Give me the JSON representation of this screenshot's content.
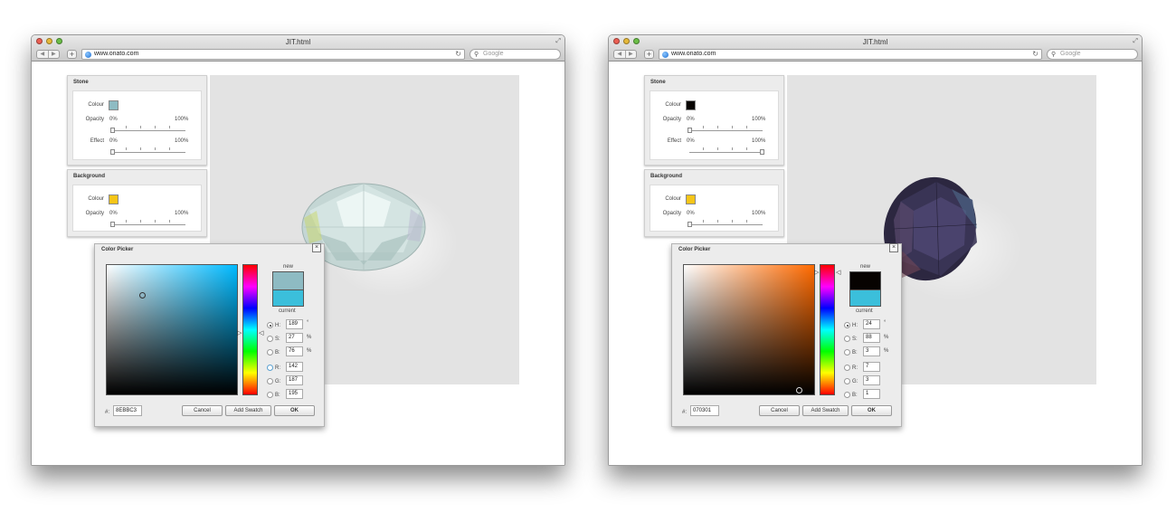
{
  "browser": {
    "title": "JIT.html",
    "url": "www.onato.com",
    "search_placeholder": "Google"
  },
  "panels": {
    "stone_title": "Stone",
    "background_title": "Background",
    "colour_label": "Colour",
    "opacity_label": "Opacity",
    "effect_label": "Effect",
    "min_pct": "0%",
    "max_pct": "100%"
  },
  "picker": {
    "title": "Color Picker",
    "close_glyph": "×",
    "new_label": "new",
    "current_label": "current",
    "h_label": "H:",
    "s_label": "S:",
    "b_label": "B:",
    "r_label": "R:",
    "g_label": "G:",
    "b2_label": "B:",
    "deg_unit": "°",
    "pct_unit": "%",
    "hex_label": "#:",
    "cancel_label": "Cancel",
    "add_swatch_label": "Add Swatch",
    "ok_label": "OK"
  },
  "windows": [
    {
      "stone_colour": "#8ebbc3",
      "background_colour": "#f5c518",
      "stone_opacity": 0,
      "stone_effect": 0,
      "background_opacity": 0,
      "picker_hue_color": "#00baff",
      "new_color": "#8ebbc3",
      "current_color": "#3bbfdb",
      "h": "189",
      "s": "27",
      "b": "76",
      "r": "142",
      "g": "187",
      "b2": "195",
      "hex": "8EBBC3",
      "active_field": "h"
    },
    {
      "stone_colour": "#070301",
      "background_colour": "#f5c518",
      "stone_opacity": 0,
      "stone_effect": 1,
      "background_opacity": 0,
      "picker_hue_color": "#ff6a00",
      "new_color": "#070301",
      "current_color": "#3bbfdb",
      "h": "24",
      "s": "88",
      "b": "3",
      "r": "7",
      "g": "3",
      "b2": "1",
      "hex": "070301",
      "active_field": "h"
    }
  ]
}
